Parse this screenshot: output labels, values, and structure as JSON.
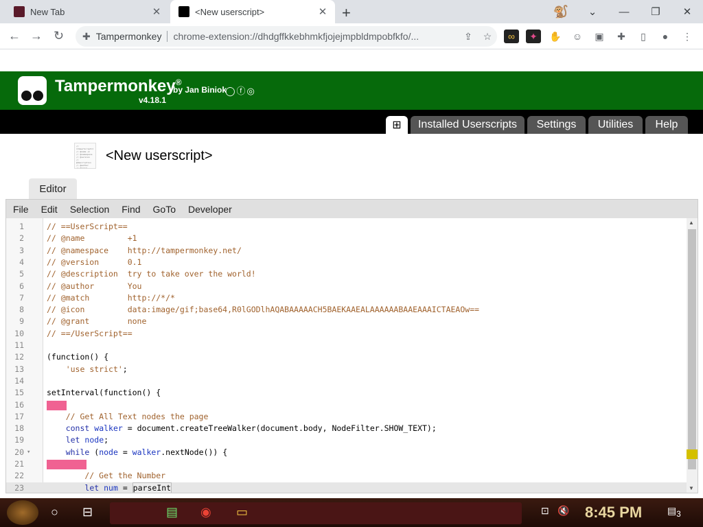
{
  "browser": {
    "tabs": [
      {
        "title": "New Tab",
        "active": false
      },
      {
        "title": "<New userscript>",
        "active": true
      }
    ],
    "site_chip": "Tampermonkey",
    "url": "chrome-extension://dhdgffkkebhmkfjojejmpbldmpobfkfo/..."
  },
  "tm": {
    "brand": "Tampermonkey",
    "byline": "by Jan Biniok",
    "version": "v4.18.1",
    "nav": [
      "Installed Userscripts",
      "Settings",
      "Utilities",
      "Help"
    ],
    "script_title": "<New userscript>",
    "editor_tab": "Editor",
    "menu": [
      "File",
      "Edit",
      "Selection",
      "Find",
      "GoTo",
      "Developer"
    ]
  },
  "code_lines": [
    "// ==UserScript==",
    "// @name         +1",
    "// @namespace    http://tampermonkey.net/",
    "// @version      0.1",
    "// @description  try to take over the world!",
    "// @author       You",
    "// @match        http://*/*",
    "// @icon         data:image/gif;base64,R0lGODlhAQABAAAAACH5BAEKAAEALAAAAAABAAEAAAICTAEAOw==",
    "// @grant        none",
    "// ==/UserScript==",
    "",
    "(function() {",
    "    'use strict';",
    "",
    "setInterval(function() {",
    "",
    "    // Get All Text nodes the page",
    "    const walker = document.createTreeWalker(document.body, NodeFilter.SHOW_TEXT);",
    "    let node;",
    "    while (node = walker.nextNode()) {",
    "",
    "        // Get the Number",
    "        let num = parseInt"
  ],
  "taskbar": {
    "time": "8:45 PM",
    "notif_count": "3"
  }
}
